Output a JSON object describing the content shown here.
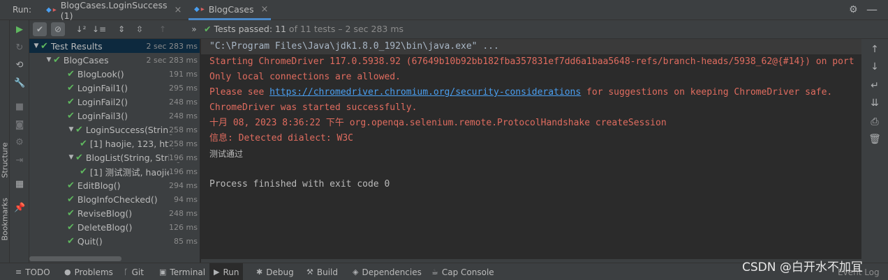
{
  "run_bar": {
    "label": "Run:",
    "tabs": [
      {
        "label": "BlogCases.LoginSuccess (1)",
        "close": "×"
      },
      {
        "label": "BlogCases",
        "close": "×"
      }
    ]
  },
  "test_toolbar": {
    "status_label": "Tests passed:",
    "passed": "11",
    "of_text": "of 11 tests – 2 sec 283 ms",
    "expand_label": "»"
  },
  "tree": {
    "rows": [
      {
        "name": "Test Results",
        "time": "2 sec 283 ms",
        "level": 0,
        "expanded": true
      },
      {
        "name": "BlogCases",
        "time": "2 sec 283 ms",
        "level": 1,
        "expanded": true
      },
      {
        "name": "BlogLook()",
        "time": "191 ms",
        "level": 2
      },
      {
        "name": "LoginFail1()",
        "time": "295 ms",
        "level": 2
      },
      {
        "name": "LoginFail2()",
        "time": "248 ms",
        "level": 2
      },
      {
        "name": "LoginFail3()",
        "time": "248 ms",
        "level": 2
      },
      {
        "name": "LoginSuccess(String, S",
        "time": "258 ms",
        "level": 2,
        "expanded": true
      },
      {
        "name": "[1] haojie, 123, http",
        "time": "258 ms",
        "level": 3
      },
      {
        "name": "BlogList(String, String",
        "time": "196 ms",
        "level": 2,
        "expanded": true
      },
      {
        "name": "[1] 测试测试, haojie",
        "time": "196 ms",
        "level": 3
      },
      {
        "name": "EditBlog()",
        "time": "294 ms",
        "level": 2
      },
      {
        "name": "BlogInfoChecked()",
        "time": "94 ms",
        "level": 2
      },
      {
        "name": "ReviseBlog()",
        "time": "248 ms",
        "level": 2
      },
      {
        "name": "DeleteBlog()",
        "time": "126 ms",
        "level": 2
      },
      {
        "name": "Quit()",
        "time": "85 ms",
        "level": 2
      }
    ]
  },
  "console": {
    "line1": "\"C:\\Program Files\\Java\\jdk1.8.0_192\\bin\\java.exe\" ...",
    "line2": "Starting ChromeDriver 117.0.5938.92 (67649b10b92bb182fba357831ef7dd6a1baa5648-refs/branch-heads/5938_62@{#14}) on port",
    "line3": "Only local connections are allowed.",
    "line4_pre": "Please see ",
    "line4_link": "https://chromedriver.chromium.org/security-considerations",
    "line4_post": " for suggestions on keeping ChromeDriver safe.",
    "line5": "ChromeDriver was started successfully.",
    "line6": "十月 08, 2023 8:36:22 下午 org.openqa.selenium.remote.ProtocolHandshake createSession",
    "line7": "信息: Detected dialect: W3C",
    "line8": "测试通过",
    "line9": "Process finished with exit code 0"
  },
  "side_tabs": {
    "structure": "Structure",
    "bookmarks": "Bookmarks"
  },
  "bottom_bar": {
    "tabs": [
      {
        "label": "TODO",
        "icon": "≡"
      },
      {
        "label": "Problems",
        "icon": "●"
      },
      {
        "label": "Git",
        "icon": "ᚴ"
      },
      {
        "label": "Terminal",
        "icon": "▣"
      },
      {
        "label": "Run",
        "icon": "▶"
      },
      {
        "label": "Debug",
        "icon": "✱"
      },
      {
        "label": "Build",
        "icon": "⚒"
      },
      {
        "label": "Dependencies",
        "icon": "◈"
      },
      {
        "label": "Cap Console",
        "icon": "☕"
      }
    ],
    "event_log": "Event Log"
  },
  "watermark": "CSDN @白开水不加冝",
  "colors": {
    "pass_green": "#5fb85f",
    "error_red": "#e06c5f",
    "link_blue": "#4a9ff0",
    "panel_bg": "#3c3f41",
    "console_bg": "#2b2b2b"
  }
}
